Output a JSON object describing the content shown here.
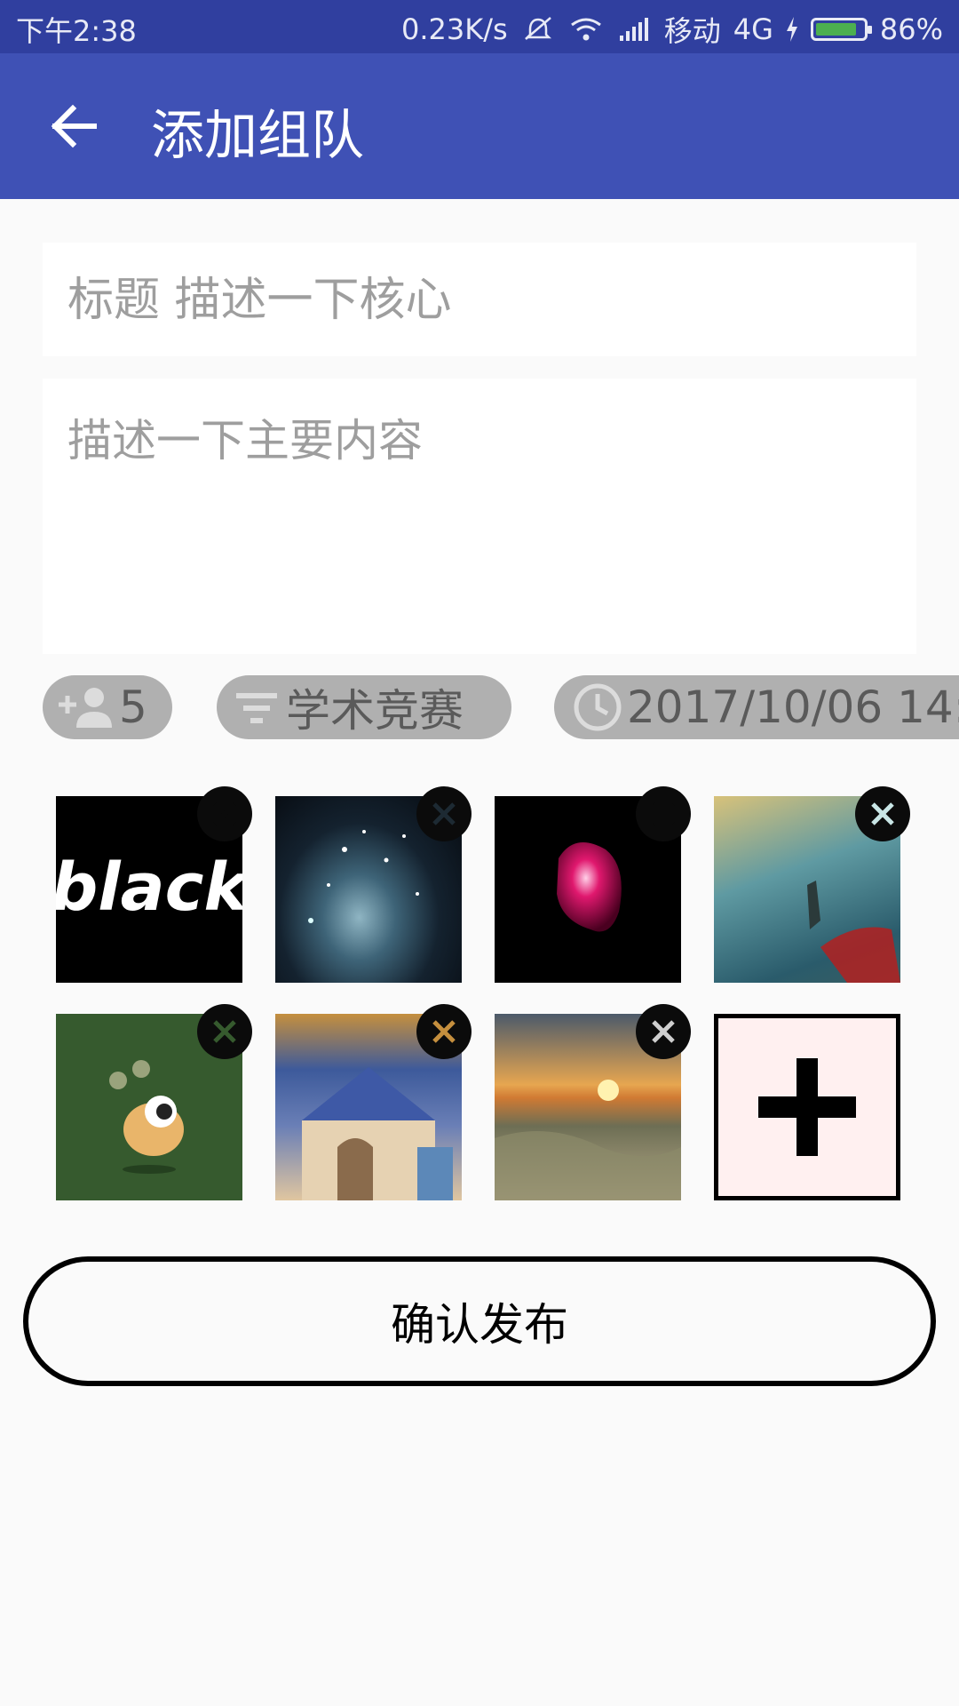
{
  "status_bar": {
    "time": "下午2:38",
    "speed": "0.23K/s",
    "carrier": "移动",
    "network": "4G",
    "battery": "86%",
    "battery_level": 0.86,
    "battery_color": "#4caf50"
  },
  "app_bar": {
    "title": "添加组队",
    "back_icon": "arrow-back-icon",
    "color": "#3f51b5"
  },
  "form": {
    "title_placeholder": "标题 描述一下核心",
    "title_value": "",
    "description_placeholder": "描述一下主要内容",
    "description_value": ""
  },
  "chips": {
    "members_icon": "add-person-icon",
    "members": "5",
    "category_icon": "filter-icon",
    "category": "学术竞赛",
    "time_icon": "clock-icon",
    "time": "2017/10/06 14:"
  },
  "images": [
    {
      "name": "image-black-text",
      "remove_icon": "close-icon"
    },
    {
      "name": "image-nebula",
      "remove_icon": "close-icon"
    },
    {
      "name": "image-red-gem",
      "remove_icon": "close-icon"
    },
    {
      "name": "image-sea-warrior",
      "remove_icon": "close-icon"
    },
    {
      "name": "image-cartoon-pug",
      "remove_icon": "close-icon"
    },
    {
      "name": "image-cathedral",
      "remove_icon": "close-icon"
    },
    {
      "name": "image-sunset-coast",
      "remove_icon": "close-icon"
    }
  ],
  "thumb_texts": {
    "black": "black"
  },
  "add_image_icon": "plus-icon",
  "confirm_button": "确认发布"
}
